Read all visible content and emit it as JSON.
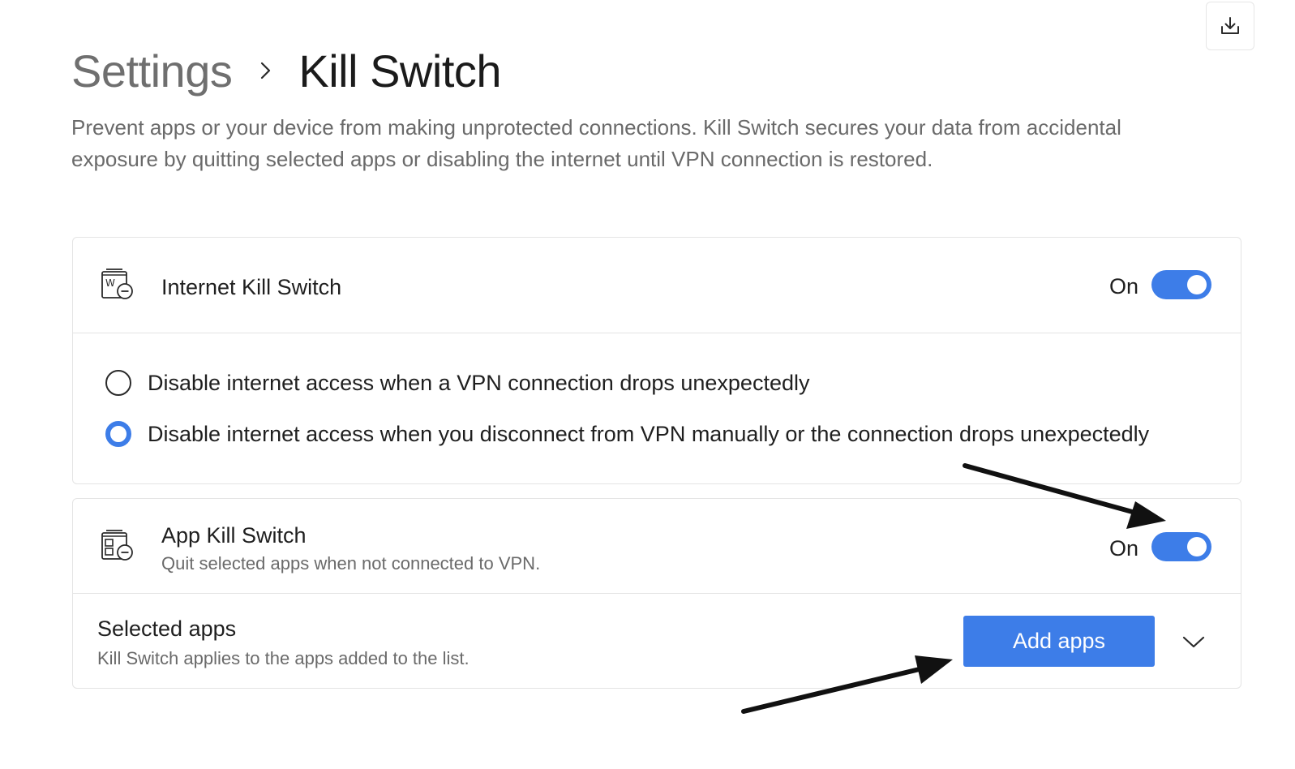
{
  "header": {
    "breadcrumb_parent": "Settings",
    "breadcrumb_current": "Kill Switch",
    "description": "Prevent apps or your device from making unprotected connections. Kill Switch secures your data from accidental exposure by quitting selected apps or disabling the internet until VPN connection is restored."
  },
  "toolbar": {
    "download_icon": "download-icon"
  },
  "internet_kill_switch": {
    "title": "Internet Kill Switch",
    "icon": "internet-kill-switch-icon",
    "toggle_label": "On",
    "enabled": true,
    "options": [
      {
        "label": "Disable internet access when a VPN connection drops unexpectedly",
        "selected": false
      },
      {
        "label": "Disable internet access when you disconnect from VPN manually or the connection drops unexpectedly",
        "selected": true
      }
    ]
  },
  "app_kill_switch": {
    "title": "App Kill Switch",
    "subtitle": "Quit selected apps when not connected to VPN.",
    "icon": "app-kill-switch-icon",
    "toggle_label": "On",
    "enabled": true,
    "selected_apps": {
      "title": "Selected apps",
      "subtitle": "Kill Switch applies to the apps added to the list.",
      "add_button_label": "Add apps",
      "expand_icon": "chevron-down-icon"
    }
  },
  "colors": {
    "accent": "#3d7de8",
    "text_primary": "#1f1f1f",
    "text_secondary": "#6a6a6a",
    "border": "#e4e4e4",
    "annotation_arrow": "#111111"
  }
}
